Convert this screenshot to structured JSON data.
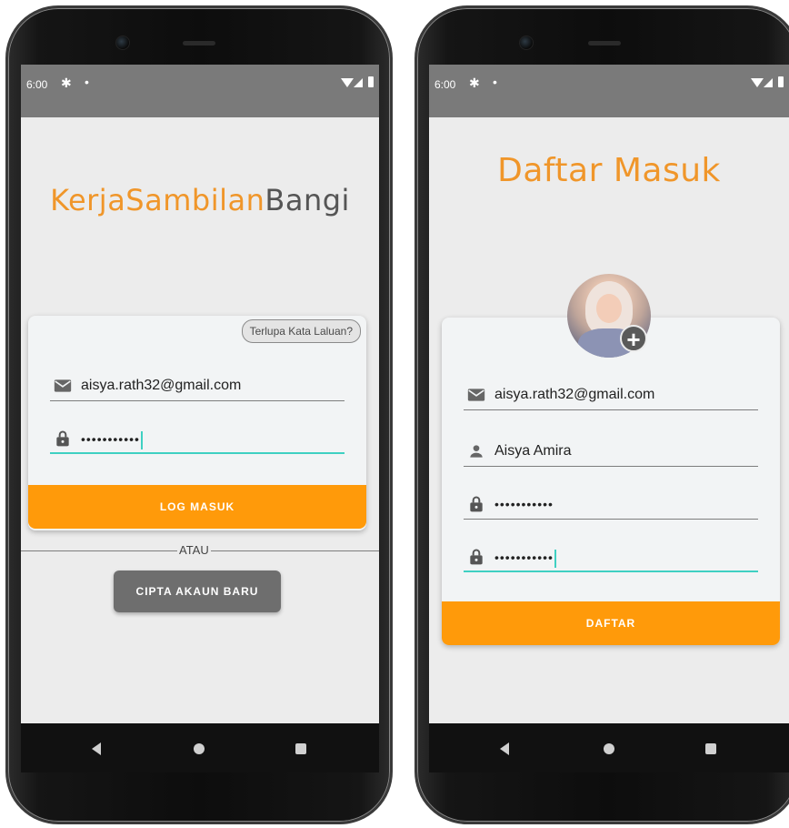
{
  "login_screen": {
    "status_time": "6:00",
    "app_title_part1": "KerjaSambilan",
    "app_title_part2": "Bangi",
    "forgot_password": "Terlupa Kata Laluan?",
    "email_value": "aisya.rath32@gmail.com",
    "password_value": "•••••••••••",
    "login_button": "LOG MASUK",
    "or_text": "ATAU",
    "create_account_button": "CIPTA AKAUN BARU"
  },
  "register_screen": {
    "status_time": "6:00",
    "title": "Daftar Masuk",
    "email_value": "aisya.rath32@gmail.com",
    "name_value": "Aisya Amira",
    "password_value": "•••••••••••",
    "confirm_password_value": "•••••••••••",
    "register_button": "DAFTAR",
    "add_photo_symbol": "+"
  },
  "colors": {
    "accent_orange": "#ff9a0a",
    "title_orange": "#f0962a",
    "focus_teal": "#3fd0c2",
    "secondary_button": "#6e6e6e",
    "status_bar": "#7a7a7a"
  },
  "icons": [
    "settings-icon",
    "wifi-icon",
    "signal-icon",
    "battery-icon",
    "email-icon",
    "lock-icon",
    "person-icon",
    "add-photo-icon",
    "nav-back-icon",
    "nav-home-icon",
    "nav-recents-icon"
  ]
}
